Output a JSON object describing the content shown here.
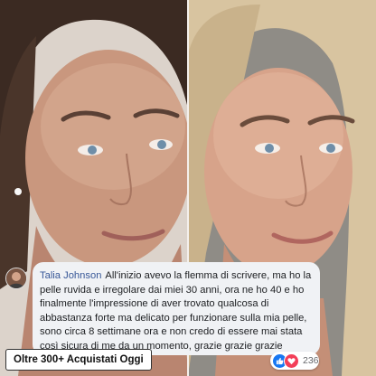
{
  "photos": {
    "before_description": "",
    "after_description": ""
  },
  "comment": {
    "author": "Talia Johnson",
    "text": "All'inizio avevo la flemma di scrivere, ma ho la pelle ruvida e irregolare dai miei 30 anni, ora ne ho 40 e ho finalmente l'impressione di aver trovato qualcosa di abbastanza forte ma delicato per funzionare sulla mia pelle, sono circa 8 settimane ora e non credo di essere mai stata così sicura di me da un momento, grazie grazie grazie"
  },
  "reactions": {
    "icons": [
      "like-icon",
      "love-icon"
    ],
    "count": "236"
  },
  "badge": {
    "label": "Oltre 300+ Acquistati Oggi"
  },
  "colors": {
    "author_link": "#385898",
    "bubble": "#f0f2f5",
    "like": "#1877f2",
    "love": "#f33e58"
  }
}
